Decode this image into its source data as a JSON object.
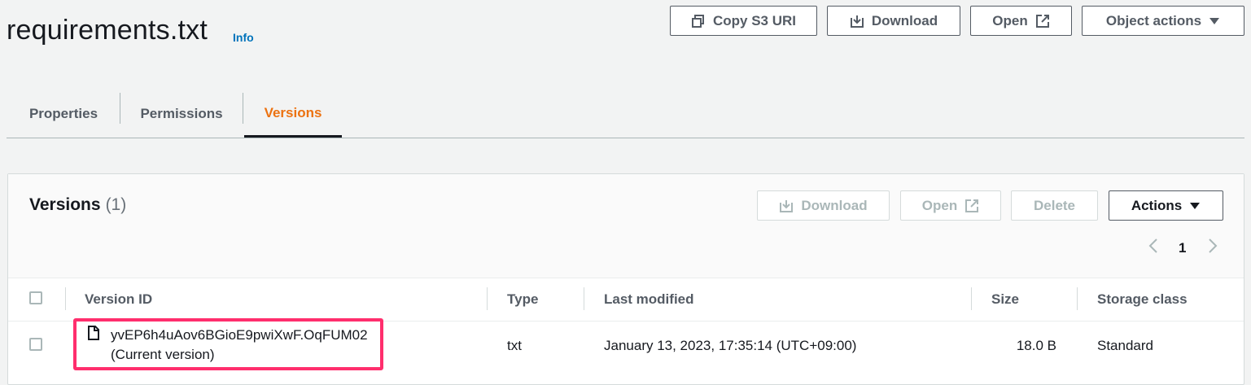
{
  "header": {
    "title": "requirements.txt",
    "info_label": "Info",
    "buttons": {
      "copy_s3_uri": "Copy S3 URI",
      "download": "Download",
      "open": "Open",
      "object_actions": "Object actions"
    }
  },
  "tabs": [
    {
      "label": "Properties",
      "active": false
    },
    {
      "label": "Permissions",
      "active": false
    },
    {
      "label": "Versions",
      "active": true
    }
  ],
  "versions_panel": {
    "title": "Versions",
    "count": "(1)",
    "buttons": {
      "download": "Download",
      "open": "Open",
      "delete": "Delete",
      "actions": "Actions"
    },
    "pagination": {
      "current_page": "1"
    },
    "columns": [
      "Version ID",
      "Type",
      "Last modified",
      "Size",
      "Storage class"
    ],
    "rows": [
      {
        "version_id": "yvEP6h4uAov6BGioE9pwiXwF.OqFUM02",
        "version_note": "(Current version)",
        "type": "txt",
        "last_modified": "January 13, 2023, 17:35:14 (UTC+09:00)",
        "size": "18.0 B",
        "storage_class": "Standard"
      }
    ]
  },
  "colors": {
    "accent_active_tab": "#ec7211",
    "link": "#0073bb",
    "highlight_border": "#ff2e6d"
  },
  "icons": [
    "copy-icon",
    "download-icon",
    "external-link-icon",
    "caret-down-icon",
    "file-icon",
    "chevron-left-icon",
    "chevron-right-icon"
  ]
}
